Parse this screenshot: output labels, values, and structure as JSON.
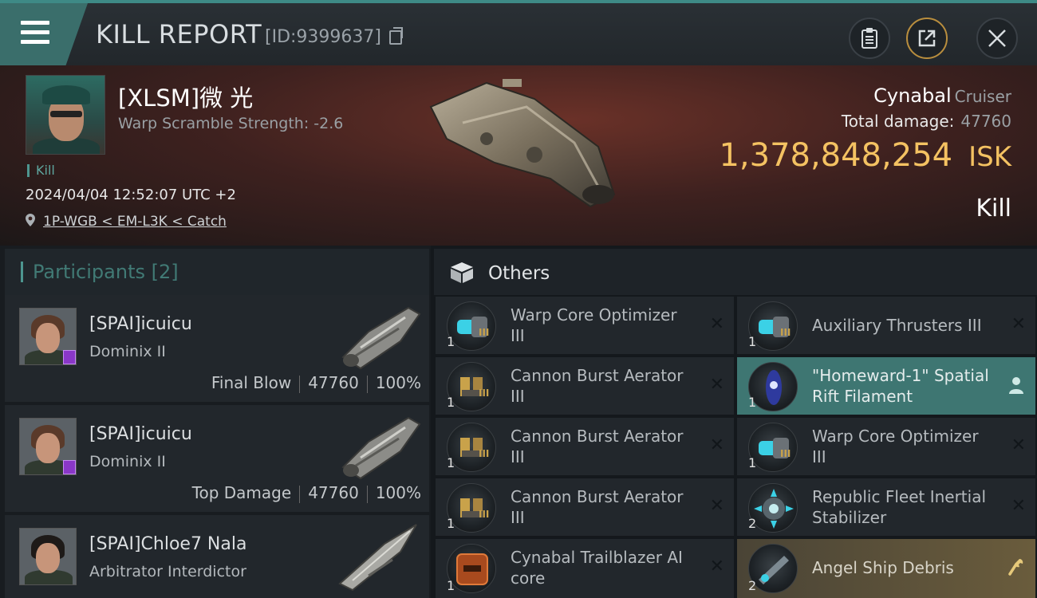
{
  "header": {
    "title": "KILL REPORT",
    "report_id": "[ID:9399637]"
  },
  "victim": {
    "name": "[XLSM]微 光",
    "scramble": "Warp Scramble Strength: -2.6",
    "tag": "Kill",
    "timestamp": "2024/04/04 12:52:07 UTC +2",
    "location": "1P-WGB < EM-L3K < Catch",
    "ship_name": "Cynabal",
    "ship_class": "Cruiser",
    "total_damage_label": "Total damage:",
    "total_damage": "47760",
    "isk_value": "1,378,848,254",
    "isk_unit": "ISK",
    "result": "Kill"
  },
  "participants": {
    "title": "Participants",
    "count": "[2]",
    "rows": [
      {
        "name": "[SPAI]icuicu",
        "ship": "Dominix II",
        "role": "Final Blow",
        "damage": "47760",
        "percent": "100%"
      },
      {
        "name": "[SPAI]icuicu",
        "ship": "Dominix II",
        "role": "Top Damage",
        "damage": "47760",
        "percent": "100%"
      },
      {
        "name": "[SPAI]Chloe7 Nala",
        "ship": "Arbitrator Interdictor",
        "role": "",
        "damage": "",
        "percent": ""
      }
    ]
  },
  "others": {
    "title": "Others",
    "left_items": [
      {
        "name": "Warp Core Optimizer III",
        "qty": "1",
        "tier": "III"
      },
      {
        "name": "Cannon Burst Aerator III",
        "qty": "1",
        "tier": "III"
      },
      {
        "name": "Cannon Burst Aerator III",
        "qty": "1",
        "tier": "III"
      },
      {
        "name": "Cannon Burst Aerator III",
        "qty": "1",
        "tier": "III"
      },
      {
        "name": "Cynabal Trailblazer AI core",
        "qty": "1",
        "tier": ""
      }
    ],
    "right_items": [
      {
        "name": "Auxiliary Thrusters III",
        "qty": "1",
        "tier": "III"
      },
      {
        "name": "\"Homeward-1\" Spatial Rift Filament",
        "qty": "1",
        "tier": ""
      },
      {
        "name": "Warp Core Optimizer III",
        "qty": "1",
        "tier": "III"
      },
      {
        "name": "Republic Fleet Inertial Stabilizer",
        "qty": "2",
        "tier": ""
      },
      {
        "name": "Angel Ship Debris",
        "qty": "2",
        "tier": ""
      }
    ]
  },
  "colors": {
    "accent_teal": "#3e8a86",
    "isk_gold": "#f4c262",
    "badge_purple": "#8a37c8"
  }
}
